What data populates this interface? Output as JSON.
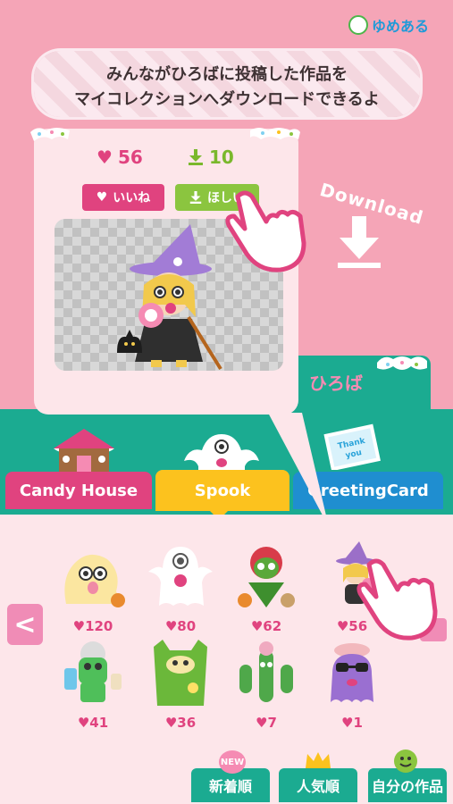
{
  "app": {
    "brand": "ゆめある"
  },
  "banner": {
    "line1": "みんながひろばに投稿した作品を",
    "line2": "マイコレクションへダウンロードできるよ"
  },
  "detail": {
    "likes": "56",
    "downloads": "10",
    "like_button": "いいね",
    "want_button": "ほしい"
  },
  "download_hint": "Download",
  "plaza_label": "ひろば",
  "categories": [
    {
      "label": "Candy House"
    },
    {
      "label": "Spook"
    },
    {
      "label": "GreetingCard"
    }
  ],
  "card_art_text": "Thank you",
  "gallery": [
    {
      "likes": "120",
      "icon": "yellow-ghost"
    },
    {
      "likes": "80",
      "icon": "white-ghost"
    },
    {
      "likes": "62",
      "icon": "green-plant-monster"
    },
    {
      "likes": "56",
      "icon": "witch-girl"
    },
    {
      "likes": "41",
      "icon": "green-zombie"
    },
    {
      "likes": "36",
      "icon": "green-cat"
    },
    {
      "likes": "7",
      "icon": "cactus-monster"
    },
    {
      "likes": "1",
      "icon": "purple-octopus"
    }
  ],
  "heart_symbol": "♥",
  "nav_prev": "<",
  "sort": {
    "new_badge": "NEW",
    "newest": "新着順",
    "popular": "人気順",
    "mine": "自分の作品"
  },
  "colors": {
    "background_pink": "#f5a5b7",
    "panel_pink": "#fde6ea",
    "teal": "#1bab91",
    "magenta": "#e0437f",
    "yellow": "#fcc21e",
    "blue": "#1f8ed0",
    "lime": "#8bc53f"
  }
}
